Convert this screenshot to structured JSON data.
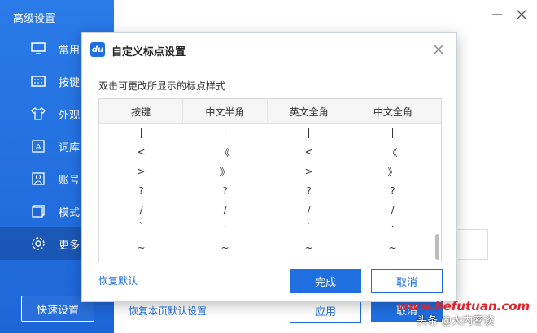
{
  "background": {
    "sidebar_title": "高级设置",
    "sidebar_items": [
      {
        "label": "常用",
        "icon": "monitor-icon"
      },
      {
        "label": "按键",
        "icon": "keyboard-icon"
      },
      {
        "label": "外观",
        "icon": "shirt-icon"
      },
      {
        "label": "词库",
        "icon": "letter-a-icon"
      },
      {
        "label": "账号",
        "icon": "user-icon"
      },
      {
        "label": "模式",
        "icon": "mode-icon"
      },
      {
        "label": "更多",
        "icon": "gear-icon"
      }
    ],
    "active_item": "更多",
    "quick_settings": "快速设置",
    "restore_page_default": "恢复本页默认设置",
    "apply": "应用",
    "cancel": "取消"
  },
  "dialog": {
    "title": "自定义标点设置",
    "subtitle": "双击可更改所显示的标点样式",
    "columns": [
      "按键",
      "中文半角",
      "英文全角",
      "中文全角"
    ],
    "rows": [
      [
        "|",
        "|",
        "|",
        "|"
      ],
      [
        "<",
        "《",
        "<",
        "《"
      ],
      [
        ">",
        "》",
        ">",
        "》"
      ],
      [
        "?",
        "?",
        "?",
        "?"
      ],
      [
        "/",
        "/",
        "/",
        "/"
      ],
      [
        "`",
        "·",
        "`",
        "·"
      ],
      [
        "~",
        "~",
        "~",
        "~"
      ]
    ],
    "restore_default": "恢复默认",
    "done": "完成",
    "cancel": "取消"
  },
  "watermark": {
    "url": "www.liefutuan.com",
    "text": "头条 @大内密谈"
  },
  "colors": {
    "accent": "#1f6fe0",
    "sidebar": "#1d66d8"
  }
}
